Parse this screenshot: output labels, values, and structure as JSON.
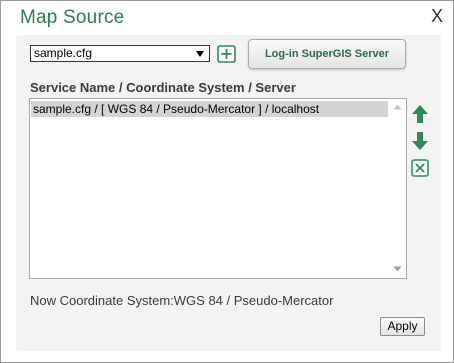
{
  "dialog": {
    "title": "Map Source",
    "close_label": "X"
  },
  "source_select": {
    "selected": "sample.cfg"
  },
  "toolbar": {
    "login_label": "Log-in SuperGIS Server"
  },
  "list": {
    "header": "Service Name / Coordinate System / Server",
    "items": [
      {
        "label": "sample.cfg / [ WGS 84 / Pseudo-Mercator ] / localhost"
      }
    ]
  },
  "status": {
    "text": "Now Coordinate System:WGS 84 / Pseudo-Mercator"
  },
  "footer": {
    "apply_label": "Apply"
  },
  "colors": {
    "title_green": "#2e7d4f",
    "icon_green": "#2e8b57",
    "selection": "#d4d4d4"
  },
  "icons": {
    "add": "plus-square-icon",
    "move_up": "arrow-up-icon",
    "move_down": "arrow-down-icon",
    "delete": "close-square-icon"
  }
}
